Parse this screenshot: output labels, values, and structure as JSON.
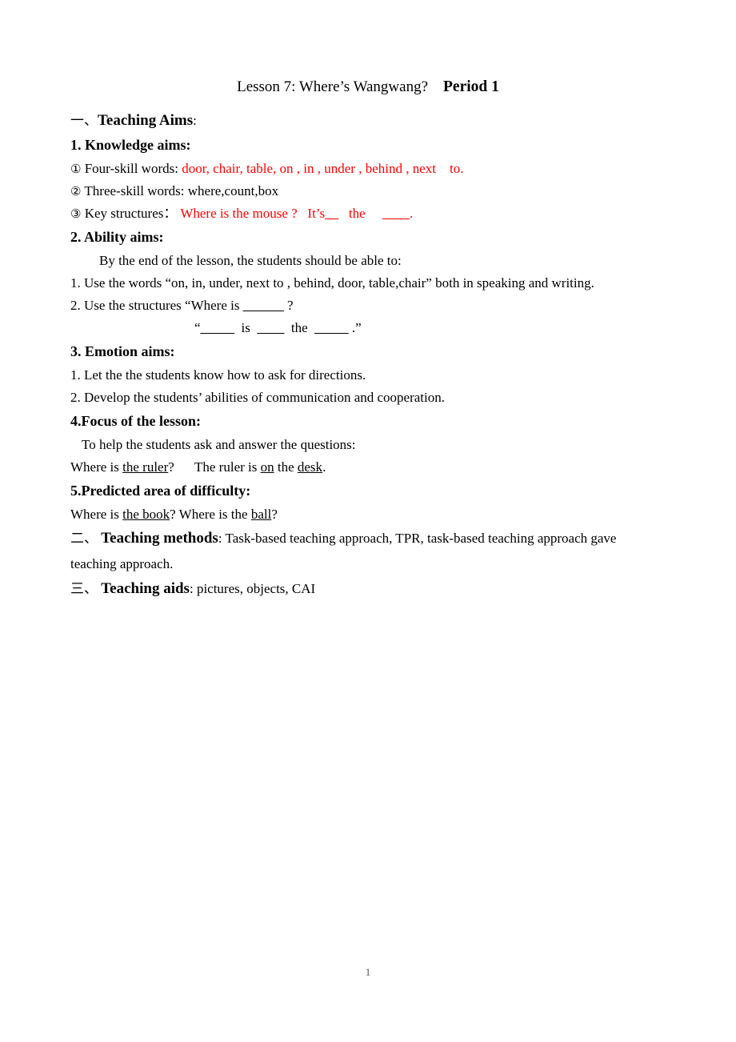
{
  "document": {
    "title_main": "Lesson 7: Where’s Wangwang?",
    "title_period": "Period 1",
    "footer_page_number": "1",
    "accent_red": "#FF0000"
  },
  "sections": {
    "teaching_aims": {
      "cn_numeral": "一、",
      "heading": "Teaching Aims",
      "colon": ":"
    },
    "knowledge_aims": {
      "heading": "1. Knowledge aims:",
      "item1_marker": "①",
      "item1_label": "Four-skill words:",
      "item1_value": "door, chair, table, on , in , under , behind , next    to.",
      "item2_marker": "②",
      "item2_label": "Three-skill words:",
      "item2_value": "where,count,box",
      "item3_marker": "③",
      "item3_label": "Key structures：",
      "item3_value_a": "Where is the mouse ?",
      "item3_value_b": "It’s",
      "item3_blank_1": "__",
      "item3_value_c": "the",
      "item3_blank_2": "____",
      "item3_value_d": "."
    },
    "ability_aims": {
      "heading": "2. Ability aims:",
      "intro": "By the end of the lesson, the students should be able to:",
      "item1": "1. Use the words “on, in, under, next to , behind, door, table,chair” both in speaking and writing.",
      "item2_a": "2. Use the structures “Where is",
      "item2_blank": "______",
      "item2_b": "?",
      "item2_line2_open": "“",
      "item2_line2_blank1": "_____",
      "item2_line2_is": "is",
      "item2_line2_blank2": "____",
      "item2_line2_the": "the",
      "item2_line2_blank3": "_____",
      "item2_line2_close": ".”"
    },
    "emotion_aims": {
      "heading": "3. Emotion aims:",
      "item1": "1. Let the the students know how to ask for directions.",
      "item2": "2. Develop the students’ abilities of communication and cooperation."
    },
    "focus": {
      "heading": "4.Focus of the lesson:",
      "intro": "To help the students ask and answer the questions:",
      "q_pre": "Where is ",
      "q_underlined": "the ruler",
      "q_post": "?",
      "a_pre": "The ruler is ",
      "a_underlined_1": "on",
      "a_mid": " the ",
      "a_underlined_2": "desk",
      "a_post": "."
    },
    "difficulty": {
      "heading": "5.Predicted area of difficulty:",
      "q1_pre": "Where is ",
      "q1_underlined": "the book",
      "q1_post": "? Where is the ",
      "q1_underlined_2": "ball",
      "q1_end": "?"
    },
    "teaching_methods": {
      "cn_numeral": "二、",
      "heading": "Teaching methods",
      "colon": ":",
      "body": " Task-based teaching approach, TPR, task-based teaching approach gave teaching approach."
    },
    "teaching_aids": {
      "cn_numeral": "三、",
      "heading": "Teaching aids",
      "colon": ":",
      "body": "  pictures, objects, CAI"
    }
  }
}
